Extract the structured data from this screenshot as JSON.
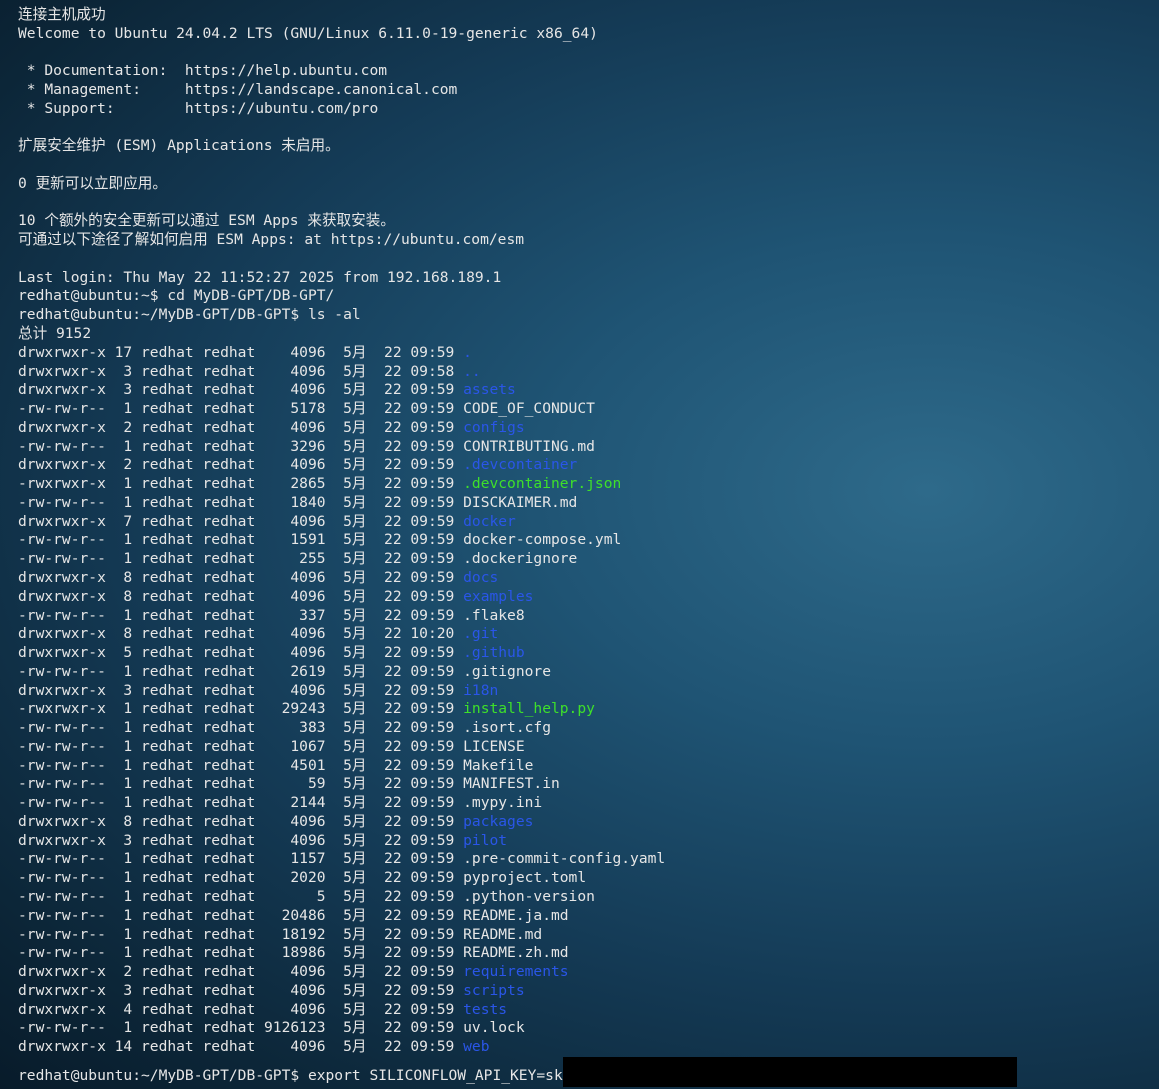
{
  "terminal": {
    "intro": [
      "连接主机成功",
      "Welcome to Ubuntu 24.04.2 LTS (GNU/Linux 6.11.0-19-generic x86_64)",
      "",
      " * Documentation:  https://help.ubuntu.com",
      " * Management:     https://landscape.canonical.com",
      " * Support:        https://ubuntu.com/pro",
      "",
      "扩展安全维护 (ESM) Applications 未启用。",
      "",
      "0 更新可以立即应用。",
      "",
      "10 个额外的安全更新可以通过 ESM Apps 来获取安装。",
      "可通过以下途径了解如何启用 ESM Apps: at https://ubuntu.com/esm",
      "",
      "Last login: Thu May 22 11:52:27 2025 from 192.168.189.1",
      "redhat@ubuntu:~$ cd MyDB-GPT/DB-GPT/",
      "redhat@ubuntu:~/MyDB-GPT/DB-GPT$ ls -al",
      "总计 9152"
    ],
    "listing": [
      {
        "prefix": "drwxrwxr-x 17 redhat redhat    4096  5月  22 09:59 ",
        "name": ".",
        "kind": "dir"
      },
      {
        "prefix": "drwxrwxr-x  3 redhat redhat    4096  5月  22 09:58 ",
        "name": "..",
        "kind": "dir"
      },
      {
        "prefix": "drwxrwxr-x  3 redhat redhat    4096  5月  22 09:59 ",
        "name": "assets",
        "kind": "dir"
      },
      {
        "prefix": "-rw-rw-r--  1 redhat redhat    5178  5月  22 09:59 ",
        "name": "CODE_OF_CONDUCT",
        "kind": "file"
      },
      {
        "prefix": "drwxrwxr-x  2 redhat redhat    4096  5月  22 09:59 ",
        "name": "configs",
        "kind": "dir"
      },
      {
        "prefix": "-rw-rw-r--  1 redhat redhat    3296  5月  22 09:59 ",
        "name": "CONTRIBUTING.md",
        "kind": "file"
      },
      {
        "prefix": "drwxrwxr-x  2 redhat redhat    4096  5月  22 09:59 ",
        "name": ".devcontainer",
        "kind": "dir"
      },
      {
        "prefix": "-rwxrwxr-x  1 redhat redhat    2865  5月  22 09:59 ",
        "name": ".devcontainer.json",
        "kind": "exec"
      },
      {
        "prefix": "-rw-rw-r--  1 redhat redhat    1840  5月  22 09:59 ",
        "name": "DISCKAIMER.md",
        "kind": "file"
      },
      {
        "prefix": "drwxrwxr-x  7 redhat redhat    4096  5月  22 09:59 ",
        "name": "docker",
        "kind": "dir"
      },
      {
        "prefix": "-rw-rw-r--  1 redhat redhat    1591  5月  22 09:59 ",
        "name": "docker-compose.yml",
        "kind": "file"
      },
      {
        "prefix": "-rw-rw-r--  1 redhat redhat     255  5月  22 09:59 ",
        "name": ".dockerignore",
        "kind": "file"
      },
      {
        "prefix": "drwxrwxr-x  8 redhat redhat    4096  5月  22 09:59 ",
        "name": "docs",
        "kind": "dir"
      },
      {
        "prefix": "drwxrwxr-x  8 redhat redhat    4096  5月  22 09:59 ",
        "name": "examples",
        "kind": "dir"
      },
      {
        "prefix": "-rw-rw-r--  1 redhat redhat     337  5月  22 09:59 ",
        "name": ".flake8",
        "kind": "file"
      },
      {
        "prefix": "drwxrwxr-x  8 redhat redhat    4096  5月  22 10:20 ",
        "name": ".git",
        "kind": "dir"
      },
      {
        "prefix": "drwxrwxr-x  5 redhat redhat    4096  5月  22 09:59 ",
        "name": ".github",
        "kind": "dir"
      },
      {
        "prefix": "-rw-rw-r--  1 redhat redhat    2619  5月  22 09:59 ",
        "name": ".gitignore",
        "kind": "file"
      },
      {
        "prefix": "drwxrwxr-x  3 redhat redhat    4096  5月  22 09:59 ",
        "name": "i18n",
        "kind": "dir"
      },
      {
        "prefix": "-rwxrwxr-x  1 redhat redhat   29243  5月  22 09:59 ",
        "name": "install_help.py",
        "kind": "exec"
      },
      {
        "prefix": "-rw-rw-r--  1 redhat redhat     383  5月  22 09:59 ",
        "name": ".isort.cfg",
        "kind": "file"
      },
      {
        "prefix": "-rw-rw-r--  1 redhat redhat    1067  5月  22 09:59 ",
        "name": "LICENSE",
        "kind": "file"
      },
      {
        "prefix": "-rw-rw-r--  1 redhat redhat    4501  5月  22 09:59 ",
        "name": "Makefile",
        "kind": "file"
      },
      {
        "prefix": "-rw-rw-r--  1 redhat redhat      59  5月  22 09:59 ",
        "name": "MANIFEST.in",
        "kind": "file"
      },
      {
        "prefix": "-rw-rw-r--  1 redhat redhat    2144  5月  22 09:59 ",
        "name": ".mypy.ini",
        "kind": "file"
      },
      {
        "prefix": "drwxrwxr-x  8 redhat redhat    4096  5月  22 09:59 ",
        "name": "packages",
        "kind": "dir"
      },
      {
        "prefix": "drwxrwxr-x  3 redhat redhat    4096  5月  22 09:59 ",
        "name": "pilot",
        "kind": "dir"
      },
      {
        "prefix": "-rw-rw-r--  1 redhat redhat    1157  5月  22 09:59 ",
        "name": ".pre-commit-config.yaml",
        "kind": "file"
      },
      {
        "prefix": "-rw-rw-r--  1 redhat redhat    2020  5月  22 09:59 ",
        "name": "pyproject.toml",
        "kind": "file"
      },
      {
        "prefix": "-rw-rw-r--  1 redhat redhat       5  5月  22 09:59 ",
        "name": ".python-version",
        "kind": "file"
      },
      {
        "prefix": "-rw-rw-r--  1 redhat redhat   20486  5月  22 09:59 ",
        "name": "README.ja.md",
        "kind": "file"
      },
      {
        "prefix": "-rw-rw-r--  1 redhat redhat   18192  5月  22 09:59 ",
        "name": "README.md",
        "kind": "file"
      },
      {
        "prefix": "-rw-rw-r--  1 redhat redhat   18986  5月  22 09:59 ",
        "name": "README.zh.md",
        "kind": "file"
      },
      {
        "prefix": "drwxrwxr-x  2 redhat redhat    4096  5月  22 09:59 ",
        "name": "requirements",
        "kind": "dir"
      },
      {
        "prefix": "drwxrwxr-x  3 redhat redhat    4096  5月  22 09:59 ",
        "name": "scripts",
        "kind": "dir"
      },
      {
        "prefix": "drwxrwxr-x  4 redhat redhat    4096  5月  22 09:59 ",
        "name": "tests",
        "kind": "dir"
      },
      {
        "prefix": "-rw-rw-r--  1 redhat redhat 9126123  5月  22 09:59 ",
        "name": "uv.lock",
        "kind": "file"
      },
      {
        "prefix": "drwxrwxr-x 14 redhat redhat    4096  5月  22 09:59 ",
        "name": "web",
        "kind": "dir"
      }
    ],
    "last_prompt": "redhat@ubuntu:~/MyDB-GPT/DB-GPT$ export SILICONFLOW_API_KEY=sk",
    "colors": {
      "text": "#e6e6e6",
      "directory": "#2a56e8",
      "executable": "#3ee02a",
      "redaction": "#000000"
    }
  }
}
